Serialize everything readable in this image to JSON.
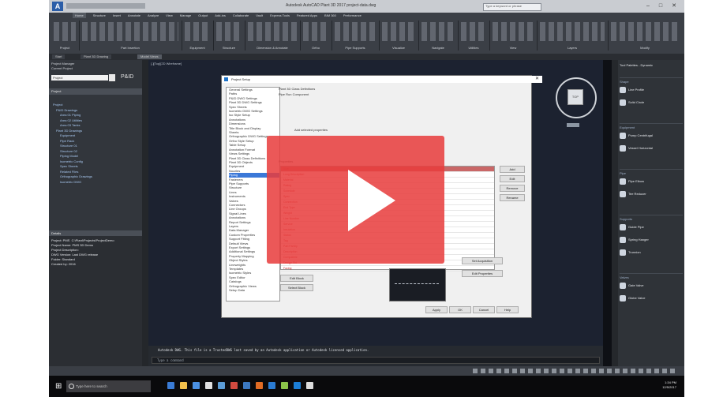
{
  "window": {
    "title": "Autodesk AutoCAD Plant 3D 2017    project-data.dwg",
    "search_placeholder": "Type a keyword or phrase",
    "min": "–",
    "max": "□",
    "close": "✕",
    "logo": "A"
  },
  "ribbon": {
    "tabs": [
      "Home",
      "Structure",
      "Insert",
      "Annotate",
      "Analyze",
      "View",
      "Manage",
      "Output",
      "Add-ins",
      "Collaborate",
      "Vault",
      "Express Tools",
      "Featured Apps",
      "BIM 360",
      "Performance"
    ],
    "active_tab": "Home",
    "groups": [
      "Project",
      "Part Insertion",
      "Equipment",
      "Structure",
      "Dimension & Annotate",
      "Ortho",
      "Pipe Supports",
      "Visualize",
      "Navigate",
      "Utilities",
      "View",
      "Layers",
      "Modify"
    ]
  },
  "file_tabs": [
    "Start",
    "Plant 3D Drawing",
    "Model Views"
  ],
  "project_manager": {
    "header_lines": [
      "Project Manager",
      "Current Project"
    ],
    "project_name": "Project",
    "btn_label": "P&ID",
    "bar_label": "Project",
    "tree": [
      "Project",
      "P&ID Drawings",
      "Area 01 Piping",
      "Area 02 Utilities",
      "Area 03 Tanks",
      "Plant 3D Drawings",
      "Equipment",
      "Pipe Rack",
      "Structure 01",
      "Structure 02",
      "Piping Model",
      "Isometric Config",
      "Spec Sheets",
      "Related Files",
      "Orthographic Drawings",
      "Isometric DWG"
    ],
    "details_title": "Details",
    "details_text": "Project: PMS  C:\\Plant\\Projects\\ProjectDemo\nProject Name: PMS 3D Demo\nProject Description:\nDWG Version: Last DWG release\nFolder: Standard\nCreated by: 2016"
  },
  "canvas": {
    "viewport_label": "[-][Top][2D Wireframe]",
    "viewcube_face": "TOP"
  },
  "dialog": {
    "title": "Project Setup",
    "close": "✕",
    "tree": [
      "General Settings",
      "Paths",
      "P&ID DWG Settings",
      "Plant 3D DWG Settings",
      "Spec Sheets",
      "Isometric DWG Settings",
      "Iso Style Setup",
      "Annotations",
      "Dimensions",
      "Title Block and Display",
      "Sheets",
      "Orthographic DWG Settings",
      "Ortho Style Setup",
      "Table Setup",
      "Annotation Format",
      "Views Settings",
      "Plant 3D Class Definitions",
      "Plant 3D Objects",
      "Equipment",
      "Nozzles",
      "Piping",
      "Fasteners",
      "Pipe Supports",
      "Structure",
      "Lines",
      "Instruments",
      "Valves",
      "Connectors",
      "Line Groups",
      "Signal Lines",
      "Annotations",
      "Report Settings",
      "Layers",
      "Data Manager",
      "Custom Properties",
      "Support Fitting",
      "Default Views",
      "Export Settings",
      "Additional Settings",
      "Property Mapping",
      "Object Styles",
      "Lineweights",
      "Templates",
      "Isometric Styles",
      "Spec Editor",
      "Catalogs",
      "Orthographic Views",
      "Setup Data"
    ],
    "tree_selected": "Piping",
    "heading": "Plant 3D Class Definitions",
    "subheading": "Pipe Run Component",
    "note": "Add selected properties",
    "section": "Properties",
    "table_rows": [
      "Size",
      "Long Description",
      "Material",
      "Rating",
      "Schedule",
      "Spec",
      "Connection",
      "End Type",
      "Weight",
      "Line Number",
      "Service",
      "Insulation",
      "Status",
      "Tag",
      "Part Family",
      "Description",
      "Compatible",
      "Design Std",
      "Facing"
    ],
    "table_selected": 0,
    "side_buttons": [
      "Add",
      "Edit",
      "Remove",
      "Rename"
    ],
    "lower_buttons": [
      "Edit Block",
      "Select Block",
      "Set Acquisition",
      "Edit Properties"
    ],
    "footer_buttons": [
      "Apply",
      "OK",
      "Cancel",
      "Help"
    ]
  },
  "properties_palette": {
    "title": "Tool Palettes - Dynamic",
    "sections": [
      {
        "title": "Shape",
        "items": [
          "Line Profile",
          "Solid Circle"
        ]
      },
      {
        "title": "Equipment",
        "items": [
          "Pump Centrifugal",
          "Vessel Horizontal"
        ]
      },
      {
        "title": "Pipe",
        "items": [
          "Pipe Elbow",
          "Tee Reducer"
        ]
      },
      {
        "title": "Supports",
        "items": [
          "Guide Pipe",
          "Spring Hanger",
          "Trunnion"
        ]
      },
      {
        "title": "Valves",
        "items": [
          "Gate Valve",
          "Globe Valve"
        ]
      }
    ]
  },
  "command_line": {
    "output": "Autodesk DWG.  This file is a TrustedDWG last saved by an Autodesk application or Autodesk licensed application.",
    "prompt": "Type a command"
  },
  "taskbar": {
    "search_label": "Type here to search",
    "time": "1:34 PM",
    "date": "12/5/2017",
    "app_colors": [
      "#3a7bd5",
      "#f2c04c",
      "#4a90e2",
      "#e0e0e0",
      "#5b9bd5",
      "#d04a3f",
      "#3c78c0",
      "#e26c24",
      "#2b7cd3",
      "#8bc34a",
      "#1c7ed6",
      "#dddddd"
    ]
  },
  "overlay": {
    "color": "#e83c3c",
    "icon": "play-icon"
  }
}
